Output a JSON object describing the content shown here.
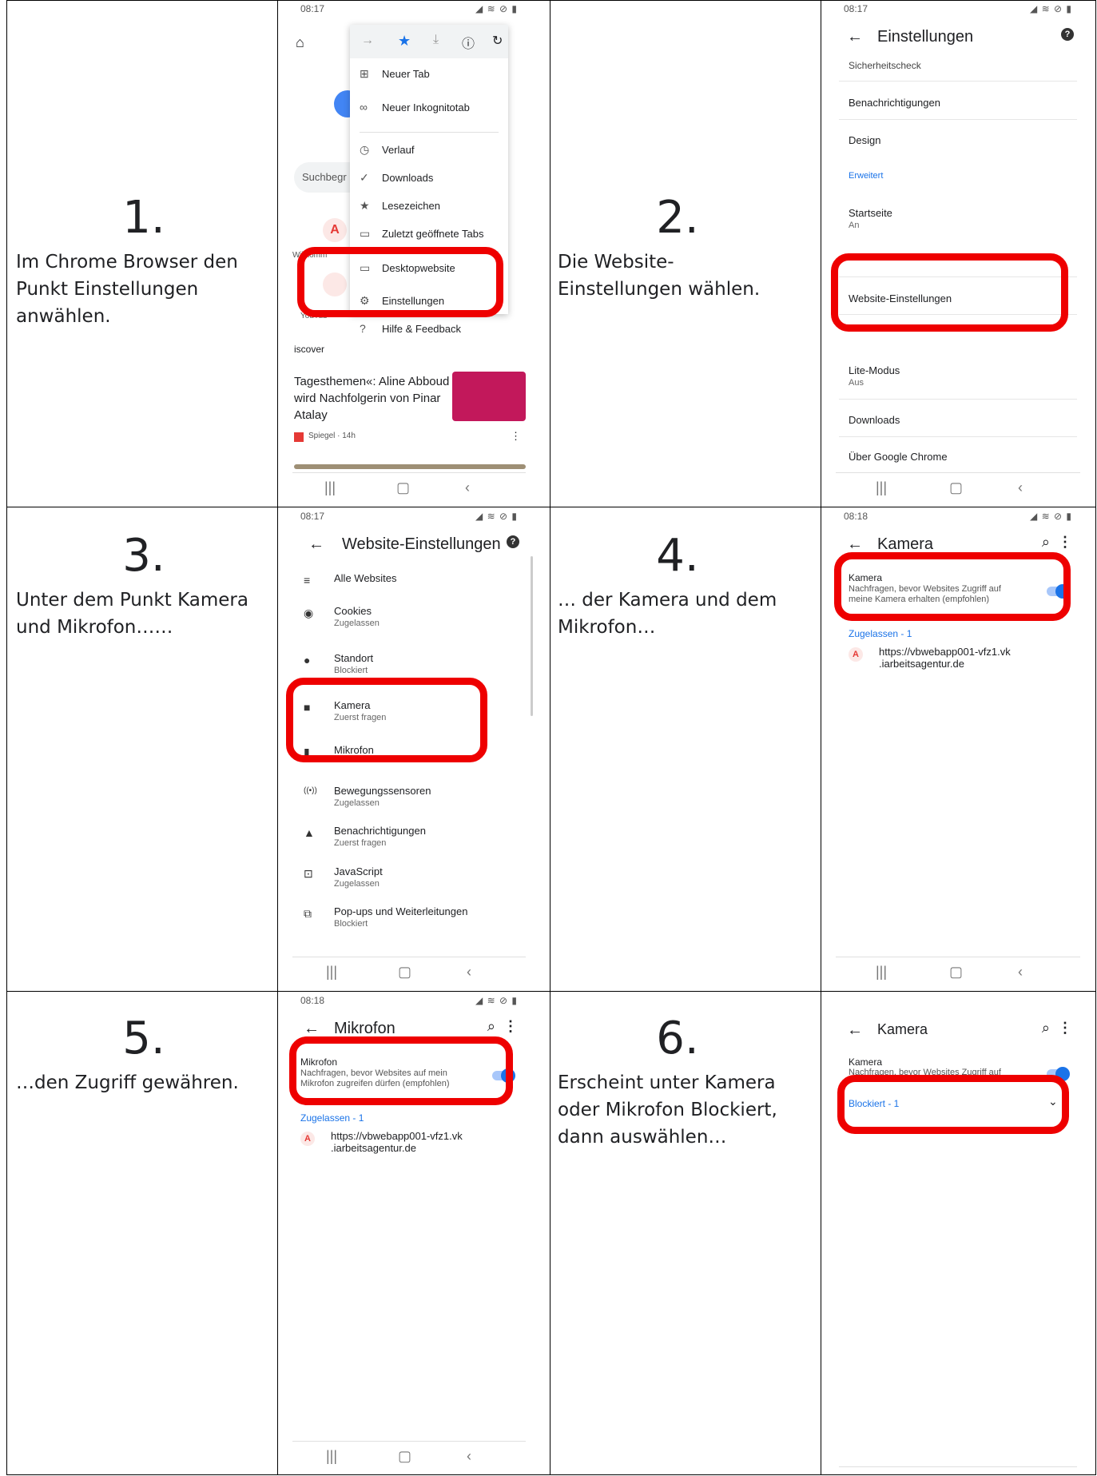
{
  "steps": [
    {
      "num": "1.",
      "desc": "Im Chrome Browser den Punkt Einstellungen anwählen."
    },
    {
      "num": "2.",
      "desc": "Die Website-Einstellungen wählen."
    },
    {
      "num": "3.",
      "desc": "Unter dem Punkt Kamera und Mikrofon……"
    },
    {
      "num": "4.",
      "desc": "… der Kamera und dem Mikrofon…"
    },
    {
      "num": "5.",
      "desc": "…den Zugriff gewähren."
    },
    {
      "num": "6.",
      "desc": "Erscheint unter Kamera oder Mikrofon Blockiert, dann auswählen…"
    }
  ],
  "highlight_color": "#ee0000",
  "accent_color": "#1a73e8",
  "screen1": {
    "time": "08:17",
    "search_placeholder": "Suchbegr",
    "shortcut_1": "Willkomm",
    "shortcut_2": "YouTub",
    "discover": "iscover",
    "news_title": "Tagesthemen«: Aline Abboud wird Nachfolgerin von Pinar Atalay",
    "news_source": "Spiegel · 14h",
    "menu": [
      "Neuer Tab",
      "Neuer Inkognitotab",
      "Verlauf",
      "Downloads",
      "Lesezeichen",
      "Zuletzt geöffnete Tabs",
      "Desktopwebsite",
      "Einstellungen",
      "Hilfe & Feedback"
    ]
  },
  "screen2": {
    "time": "08:17",
    "title": "Einstellungen",
    "cut_top": "Sicherheitscheck",
    "section_header": "Erweitert",
    "items": [
      {
        "label": "Benachrichtigungen",
        "sub": ""
      },
      {
        "label": "Design",
        "sub": ""
      },
      {
        "label": "Startseite",
        "sub": "An"
      },
      {
        "label": "Website-Einstellungen",
        "sub": ""
      },
      {
        "label": "Lite-Modus",
        "sub": "Aus"
      },
      {
        "label": "Downloads",
        "sub": ""
      },
      {
        "label": "Über Google Chrome",
        "sub": ""
      }
    ]
  },
  "screen3": {
    "time": "08:17",
    "title": "Website-Einstellungen",
    "items": [
      {
        "icon": "list-icon",
        "glyph": "≡",
        "label": "Alle Websites",
        "sub": ""
      },
      {
        "icon": "cookie-icon",
        "glyph": "◉",
        "label": "Cookies",
        "sub": "Zugelassen"
      },
      {
        "icon": "location-icon",
        "glyph": "●",
        "label": "Standort",
        "sub": "Blockiert"
      },
      {
        "icon": "camera-icon",
        "glyph": "■",
        "label": "Kamera",
        "sub": "Zuerst fragen"
      },
      {
        "icon": "microphone-icon",
        "glyph": "▮",
        "label": "Mikrofon",
        "sub": ""
      },
      {
        "icon": "sensor-icon",
        "glyph": "((•))",
        "label": "Bewegungssensoren",
        "sub": "Zugelassen"
      },
      {
        "icon": "bell-icon",
        "glyph": "▲",
        "label": "Benachrichtigungen",
        "sub": "Zuerst fragen"
      },
      {
        "icon": "javascript-icon",
        "glyph": "⊡",
        "label": "JavaScript",
        "sub": "Zugelassen"
      },
      {
        "icon": "popup-icon",
        "glyph": "⧉",
        "label": "Pop-ups und Weiterleitungen",
        "sub": "Blockiert"
      }
    ]
  },
  "screen4": {
    "time": "08:18",
    "title": "Kamera",
    "toggle_title": "Kamera",
    "toggle_desc": "Nachfragen, bevor Websites Zugriff auf meine Kamera erhalten (empfohlen)",
    "section": "Zugelassen - 1",
    "site": "https://vbwebapp001-vfz1.vk .iarbeitsagentur.de"
  },
  "screen5": {
    "time": "08:18",
    "title": "Mikrofon",
    "toggle_title": "Mikrofon",
    "toggle_desc": "Nachfragen, bevor Websites auf mein Mikrofon zugreifen dürfen (empfohlen)",
    "section": "Zugelassen - 1",
    "site": "https://vbwebapp001-vfz1.vk .iarbeitsagentur.de"
  },
  "screen6": {
    "title": "Kamera",
    "toggle_title": "Kamera",
    "toggle_desc": "Nachfragen, bevor Websites Zugriff auf meine Kamera erhalten (empfohlen)",
    "section": "Blockiert - 1"
  }
}
